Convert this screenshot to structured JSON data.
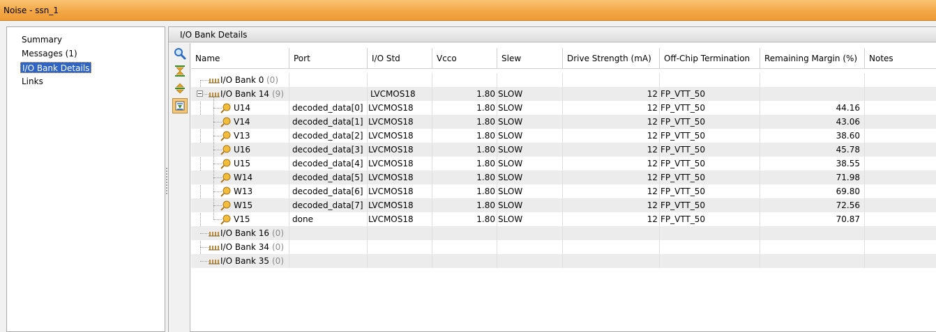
{
  "window": {
    "title": "Noise - ssn_1"
  },
  "nav": {
    "items": [
      {
        "label": "Summary",
        "selected": false
      },
      {
        "label": "Messages (1)",
        "selected": false
      },
      {
        "label": "I/O Bank Details",
        "selected": true
      },
      {
        "label": "Links",
        "selected": false
      }
    ]
  },
  "panel": {
    "title": "I/O Bank Details"
  },
  "toolbar": {
    "buttons": [
      {
        "icon": "search-icon"
      },
      {
        "icon": "collapse-all-icon"
      },
      {
        "icon": "expand-all-icon"
      },
      {
        "icon": "group-by-bank-icon",
        "active": true
      }
    ]
  },
  "table": {
    "columns": [
      "Name",
      "Port",
      "I/O Std",
      "Vcco",
      "Slew",
      "Drive Strength (mA)",
      "Off-Chip Termination",
      "Remaining Margin (%)",
      "Notes"
    ],
    "banks": [
      {
        "name": "I/O Bank 0",
        "count": "(0)",
        "expanded": false,
        "io_std": "",
        "vcco": "",
        "slew": "",
        "drive": "",
        "termination": ""
      },
      {
        "name": "I/O Bank 14",
        "count": "(9)",
        "expanded": true,
        "io_std": "LVCMOS18",
        "vcco": "1.80",
        "slew": "SLOW",
        "drive": "12",
        "termination": "FP_VTT_50",
        "pins": [
          {
            "name": "U14",
            "port": "decoded_data[0]",
            "io_std": "LVCMOS18",
            "vcco": "1.80",
            "slew": "SLOW",
            "drive": "12",
            "termination": "FP_VTT_50",
            "margin": "44.16"
          },
          {
            "name": "V14",
            "port": "decoded_data[1]",
            "io_std": "LVCMOS18",
            "vcco": "1.80",
            "slew": "SLOW",
            "drive": "12",
            "termination": "FP_VTT_50",
            "margin": "43.06"
          },
          {
            "name": "V13",
            "port": "decoded_data[2]",
            "io_std": "LVCMOS18",
            "vcco": "1.80",
            "slew": "SLOW",
            "drive": "12",
            "termination": "FP_VTT_50",
            "margin": "38.60"
          },
          {
            "name": "U16",
            "port": "decoded_data[3]",
            "io_std": "LVCMOS18",
            "vcco": "1.80",
            "slew": "SLOW",
            "drive": "12",
            "termination": "FP_VTT_50",
            "margin": "45.78"
          },
          {
            "name": "U15",
            "port": "decoded_data[4]",
            "io_std": "LVCMOS18",
            "vcco": "1.80",
            "slew": "SLOW",
            "drive": "12",
            "termination": "FP_VTT_50",
            "margin": "38.55"
          },
          {
            "name": "W14",
            "port": "decoded_data[5]",
            "io_std": "LVCMOS18",
            "vcco": "1.80",
            "slew": "SLOW",
            "drive": "12",
            "termination": "FP_VTT_50",
            "margin": "71.98"
          },
          {
            "name": "W13",
            "port": "decoded_data[6]",
            "io_std": "LVCMOS18",
            "vcco": "1.80",
            "slew": "SLOW",
            "drive": "12",
            "termination": "FP_VTT_50",
            "margin": "69.80"
          },
          {
            "name": "W15",
            "port": "decoded_data[7]",
            "io_std": "LVCMOS18",
            "vcco": "1.80",
            "slew": "SLOW",
            "drive": "12",
            "termination": "FP_VTT_50",
            "margin": "72.56"
          },
          {
            "name": "V15",
            "port": "done",
            "io_std": "LVCMOS18",
            "vcco": "1.80",
            "slew": "SLOW",
            "drive": "12",
            "termination": "FP_VTT_50",
            "margin": "70.87"
          }
        ]
      },
      {
        "name": "I/O Bank 16",
        "count": "(0)",
        "expanded": false,
        "io_std": "",
        "vcco": "",
        "slew": "",
        "drive": "",
        "termination": ""
      },
      {
        "name": "I/O Bank 34",
        "count": "(0)",
        "expanded": false,
        "io_std": "",
        "vcco": "",
        "slew": "",
        "drive": "",
        "termination": ""
      },
      {
        "name": "I/O Bank 35",
        "count": "(0)",
        "expanded": false,
        "io_std": "",
        "vcco": "",
        "slew": "",
        "drive": "",
        "termination": ""
      }
    ]
  },
  "colors": {
    "title_bar": "#f3a847",
    "selection": "#2f64c2",
    "pin_icon": "#e8a317",
    "bank_icon": "#b7893a"
  }
}
